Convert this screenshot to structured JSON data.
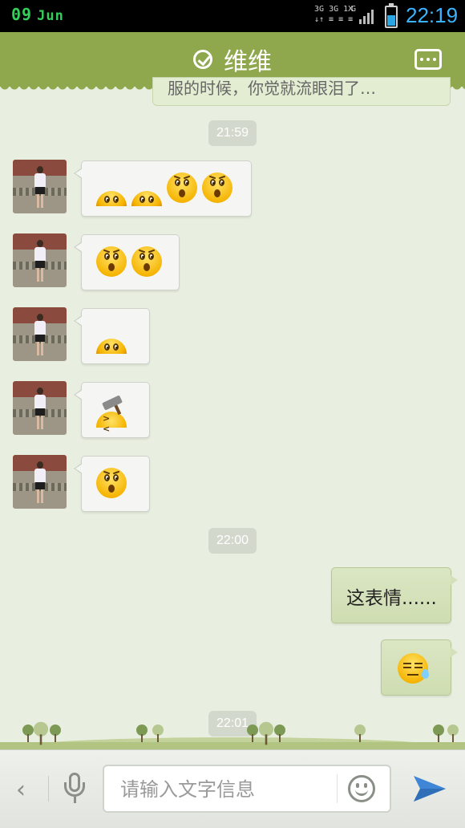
{
  "status_bar": {
    "day": "09",
    "month": "Jun",
    "network_labels": [
      "3G",
      "3G",
      "1X",
      "G"
    ],
    "time": "22:19",
    "battery_level": 0.65,
    "battery_color": "#2aa6e3"
  },
  "header": {
    "title": "维维",
    "online_icon": "check-circle-icon",
    "more_icon": "more-icon",
    "background": "#8fa84e"
  },
  "chat": {
    "cut_off_message": "服的时候，你觉就流眼泪了…",
    "timestamps": [
      "21:59",
      "22:00",
      "22:01"
    ],
    "received_messages": [
      {
        "emojis": [
          "half-face",
          "half-face",
          "shocked-face",
          "shocked-face"
        ]
      },
      {
        "emojis": [
          "shocked-face",
          "shocked-face"
        ]
      },
      {
        "emojis": [
          "half-face"
        ]
      },
      {
        "emojis": [
          "hammer-face"
        ]
      },
      {
        "emojis": [
          "shocked-face"
        ]
      }
    ],
    "sent_messages": [
      {
        "text": "这表情......"
      },
      {
        "emojis": [
          "sweat-face"
        ]
      }
    ]
  },
  "input_bar": {
    "placeholder": "请输入文字信息",
    "icons": [
      "back-icon",
      "microphone-icon",
      "emoji-icon",
      "send-icon"
    ]
  }
}
